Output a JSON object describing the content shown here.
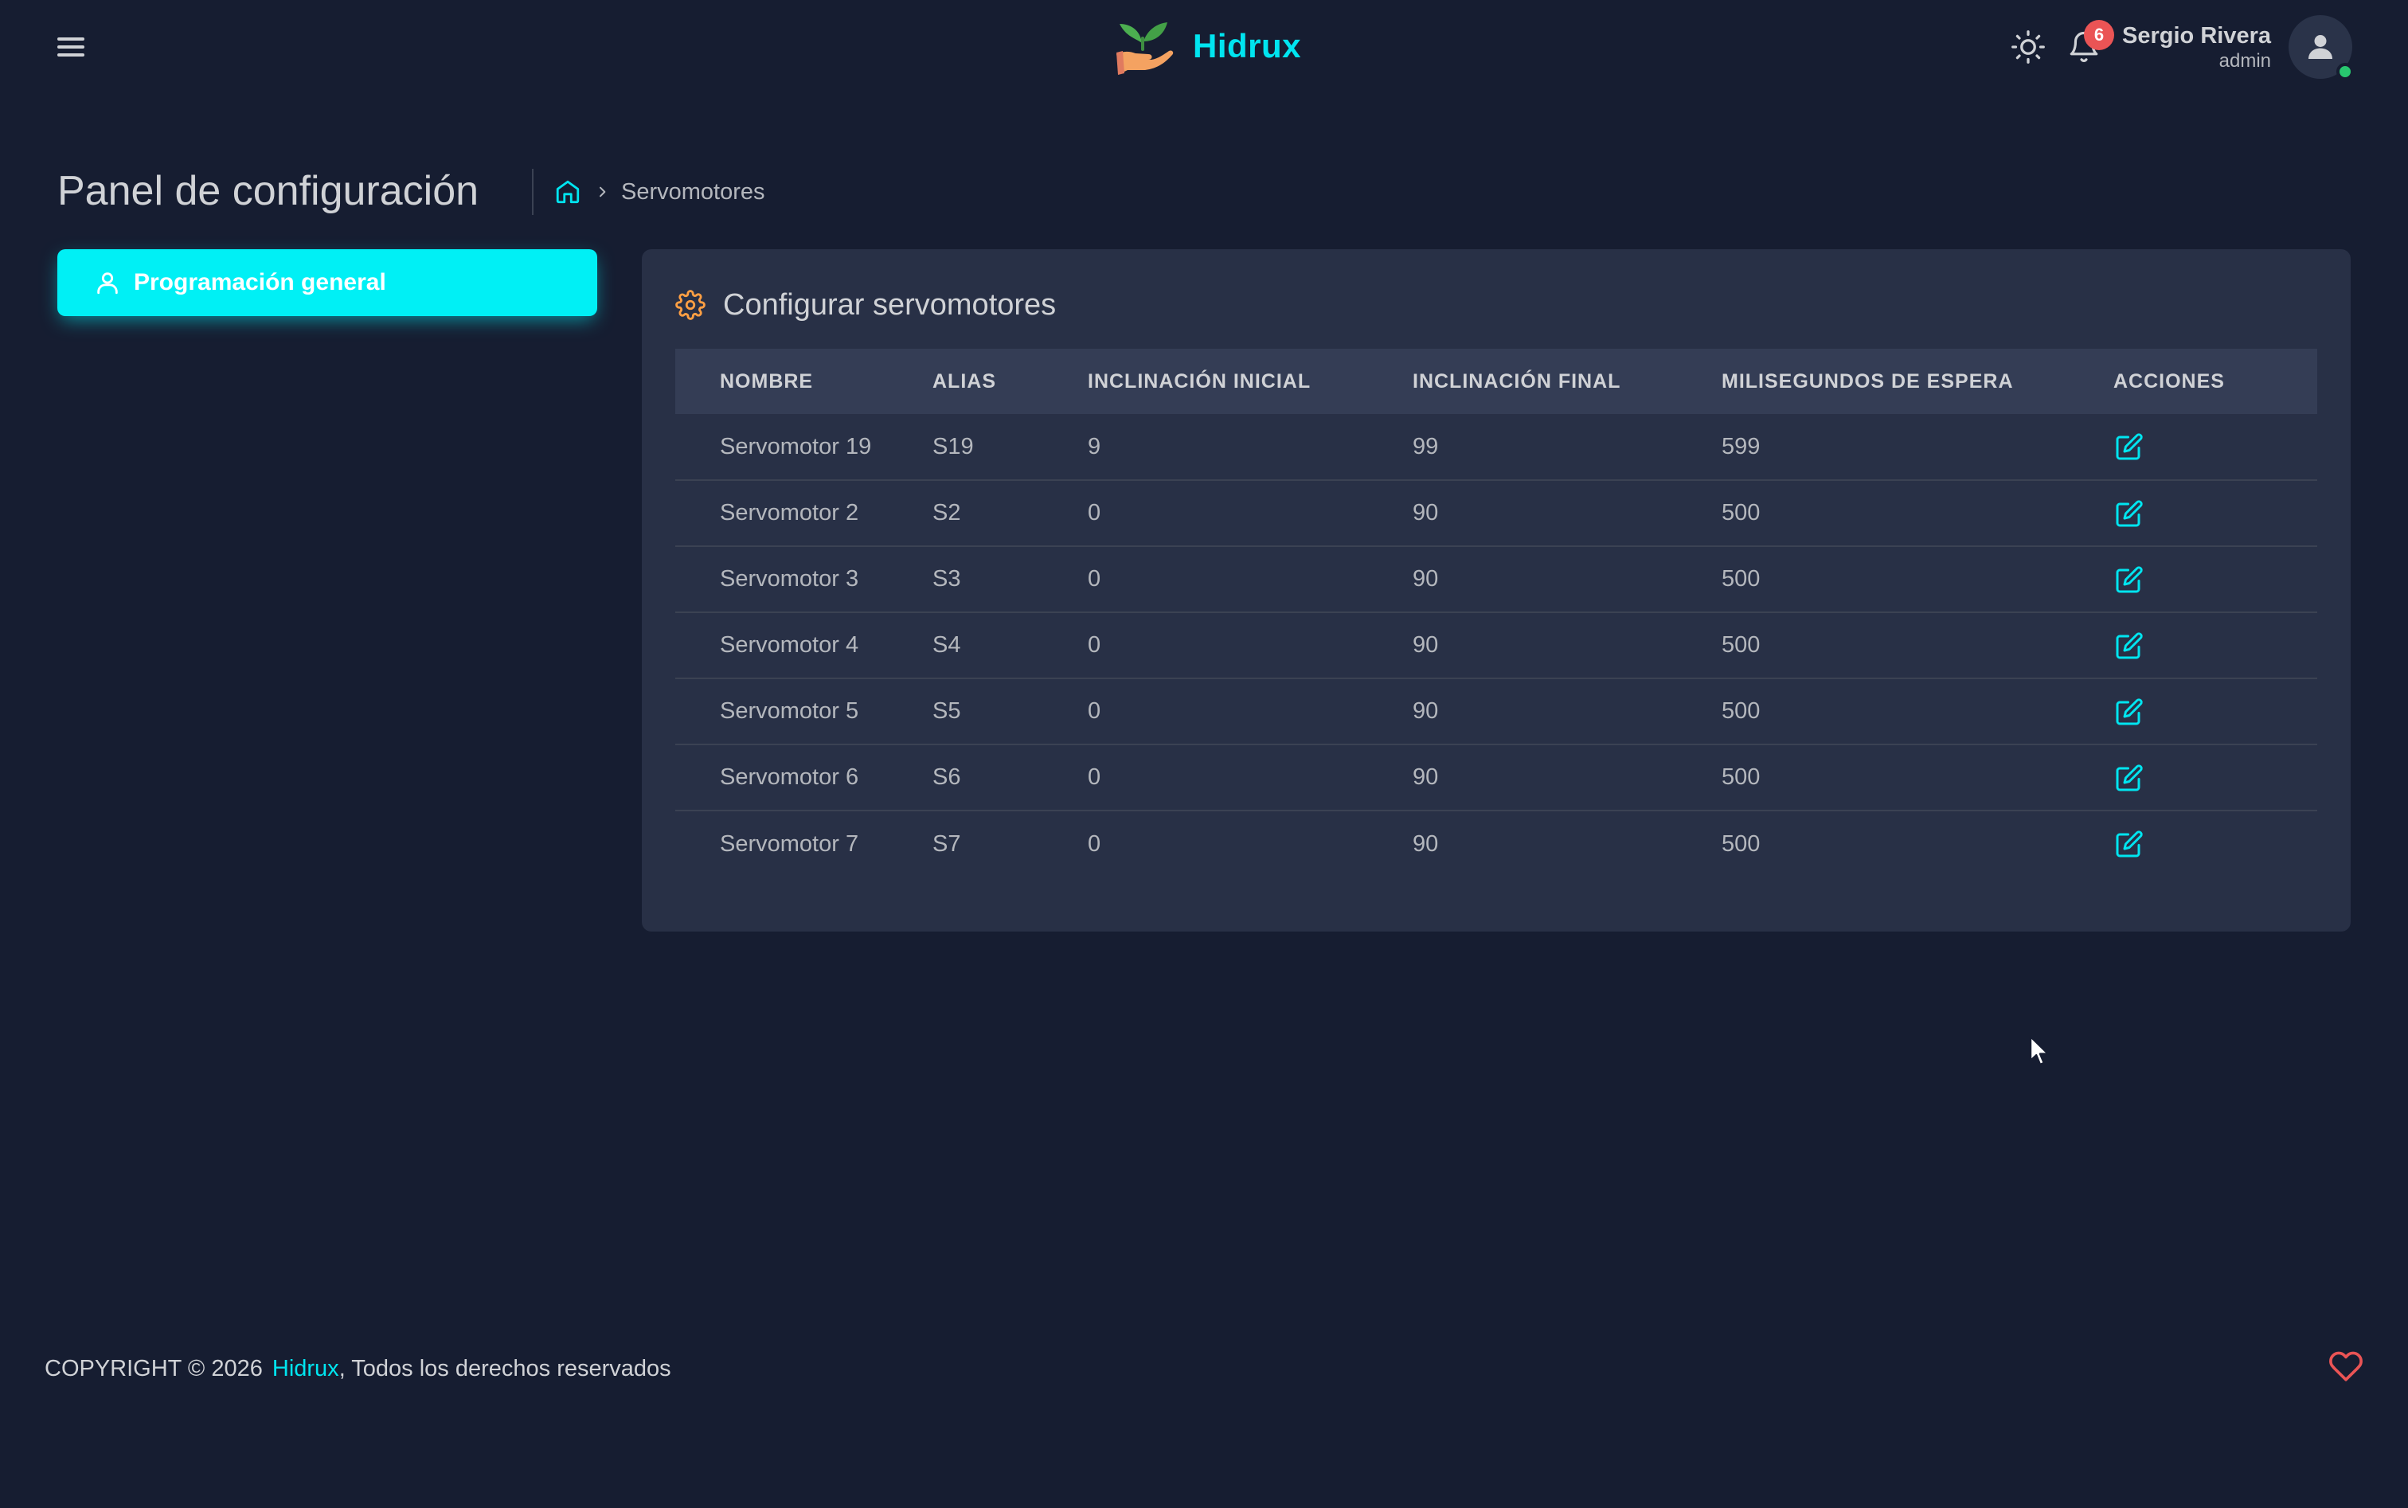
{
  "navbar": {
    "brand": "Hidrux",
    "notifications_count": "6",
    "user_name": "Sergio Rivera",
    "user_role": "admin"
  },
  "page": {
    "title": "Panel de configuración",
    "breadcrumb_current": "Servomotores"
  },
  "sidebar": {
    "button_label": "Programación general"
  },
  "card": {
    "title": "Configurar servomotores",
    "columns": [
      "NOMBRE",
      "ALIAS",
      "INCLINACIÓN INICIAL",
      "INCLINACIÓN FINAL",
      "MILISEGUNDOS DE ESPERA",
      "ACCIONES"
    ],
    "rows": [
      {
        "nombre": "Servomotor 19",
        "alias": "S19",
        "inicial": "9",
        "final": "99",
        "espera": "599"
      },
      {
        "nombre": "Servomotor 2",
        "alias": "S2",
        "inicial": "0",
        "final": "90",
        "espera": "500"
      },
      {
        "nombre": "Servomotor 3",
        "alias": "S3",
        "inicial": "0",
        "final": "90",
        "espera": "500"
      },
      {
        "nombre": "Servomotor 4",
        "alias": "S4",
        "inicial": "0",
        "final": "90",
        "espera": "500"
      },
      {
        "nombre": "Servomotor 5",
        "alias": "S5",
        "inicial": "0",
        "final": "90",
        "espera": "500"
      },
      {
        "nombre": "Servomotor 6",
        "alias": "S6",
        "inicial": "0",
        "final": "90",
        "espera": "500"
      },
      {
        "nombre": "Servomotor 7",
        "alias": "S7",
        "inicial": "0",
        "final": "90",
        "espera": "500"
      }
    ]
  },
  "footer": {
    "copyright": "COPYRIGHT © 2026",
    "brand_link": "Hidrux",
    "rights": ", Todos los derechos reservados"
  },
  "icons": {
    "menu": "hamburger-menu-icon",
    "theme": "sun-icon",
    "notifications": "bell-icon",
    "avatar": "user-icon",
    "breadcrumb_home": "home-icon",
    "sidebar_button": "user-outline-icon",
    "card_header": "gear-icon",
    "row_action": "edit-icon",
    "footer": "heart-icon"
  },
  "colors": {
    "background": "#161d31",
    "card": "#283046",
    "table_header": "#343d55",
    "accent": "#00e5f0",
    "button": "#00f0f5",
    "badge": "#ea5455",
    "online": "#28c76f",
    "gear": "#ff9f43",
    "heart": "#ea5455"
  }
}
